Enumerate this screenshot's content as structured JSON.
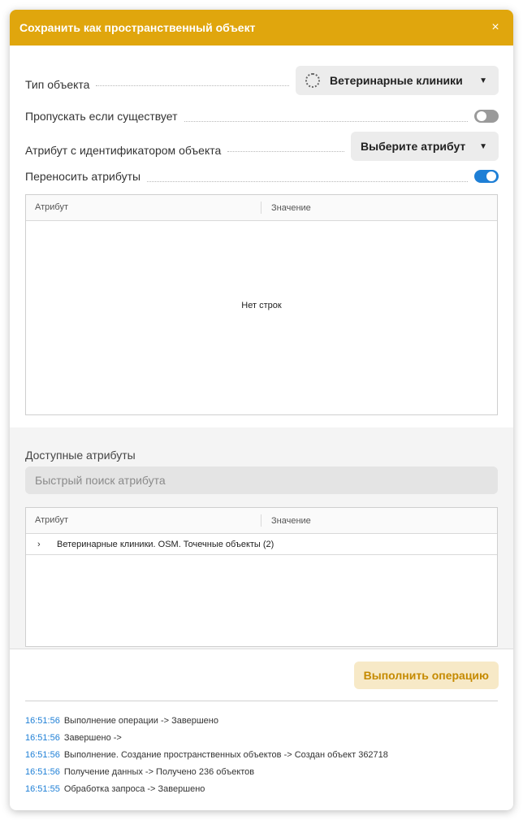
{
  "dialog": {
    "title": "Сохранить как пространственный объект",
    "close_symbol": "×"
  },
  "form": {
    "object_type": {
      "label": "Тип объекта",
      "value": "Ветеринарные клиники",
      "icon": "loading-icon"
    },
    "skip_if_exists": {
      "label": "Пропускать если существует",
      "enabled": false
    },
    "id_attribute": {
      "label": "Атрибут с идентификатором объекта",
      "value": "Выберите атрибут"
    },
    "transfer_attributes": {
      "label": "Переносить атрибуты",
      "enabled": true
    }
  },
  "mapping_table": {
    "columns": [
      "Атрибут",
      "Значение"
    ],
    "empty_text": "Нет строк"
  },
  "available": {
    "title": "Доступные атрибуты",
    "search_placeholder": "Быстрый поиск атрибута",
    "columns": [
      "Атрибут",
      "Значение"
    ],
    "rows": [
      {
        "label": "Ветеринарные клиники. OSM. Точечные объекты (2)",
        "expanded": false
      }
    ]
  },
  "actions": {
    "execute_label": "Выполнить операцию"
  },
  "log": [
    {
      "time": "16:51:56",
      "text": "Выполнение операции -> Завершено"
    },
    {
      "time": "16:51:56",
      "text": "Завершено ->"
    },
    {
      "time": "16:51:56",
      "text": "Выполнение. Создание пространственных объектов -> Создан объект 362718"
    },
    {
      "time": "16:51:56",
      "text": "Получение данных -> Получено 236 объектов"
    },
    {
      "time": "16:51:55",
      "text": "Обработка запроса -> Завершено"
    }
  ],
  "colors": {
    "header": "#e0a60d",
    "accent_blue": "#1e7fd6",
    "execute_bg": "#f7e9c7",
    "execute_text": "#c58a00"
  }
}
